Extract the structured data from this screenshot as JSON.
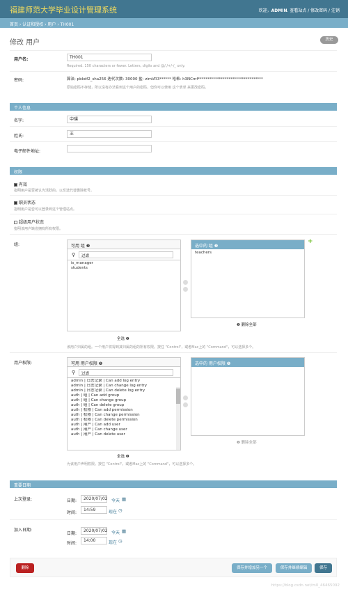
{
  "header": {
    "site_title": "福建师范大学毕业设计管理系统",
    "welcome": "欢迎，",
    "username": "ADMIN",
    "links": ". 查看站点 / 修改密码 / 注销"
  },
  "breadcrumb": "首页 › 认证和授权 › 用户 › TH001",
  "page": {
    "title": "修改 用户",
    "history_button": "历史"
  },
  "account": {
    "username_label": "用户名:",
    "username_value": "TH001",
    "username_help": "Required. 150 characters or fewer. Letters, digits and @/./+/-/_ only.",
    "password_label": "密码:",
    "password_text": "算法: pbkdf2_sha256 迭代次数: 30000 盐: zimVR3****** 哈希: h3NCmf**********************************",
    "password_help": "原始密码不存储，所以没有办法看到这个用户的密码，但你可以使用 这个表单 来更改密码。"
  },
  "personal": {
    "section_title": "个人信息",
    "first_name_label": "名字:",
    "first_name_value": "中璞",
    "last_name_label": "姓氏:",
    "last_name_value": "王",
    "email_label": "电子邮件地址:",
    "email_value": ""
  },
  "permissions": {
    "section_title": "权限",
    "active_label": "有效",
    "active_help": "指明用户是否被认为活跃的。以反选代替删除帐号。",
    "staff_label": "职员状态",
    "staff_help": "指明用户是否可以登录到这个管理站点。",
    "superuser_label": "超级用户状态",
    "superuser_help": "指明该用户缺省拥有所有权限。",
    "groups_label": "组:",
    "groups_available_title": "可用 组 ❷",
    "groups_filter": "过滤",
    "groups_available": [
      "is_manager",
      "students"
    ],
    "groups_chosen_title": "选中的 组 ❷",
    "groups_chosen": [
      "teachers"
    ],
    "groups_select_all": "全选 ❷",
    "groups_remove_all": "❷ 删除全部",
    "groups_help": "该用户归属的组。一个用户将得到其归属的组的所有权限。按住 \"Control\"，或者Mac上的 \"Command\"，可以选择多个。",
    "perms_label": "用户权限:",
    "perms_available_title": "可用 用户权限 ❷",
    "perms_filter": "过滤",
    "perms_available": [
      "admin | 日志记录 | Can add log entry",
      "admin | 日志记录 | Can change log entry",
      "admin | 日志记录 | Can delete log entry",
      "auth | 组 | Can add group",
      "auth | 组 | Can change group",
      "auth | 组 | Can delete group",
      "auth | 权限 | Can add permission",
      "auth | 权限 | Can change permission",
      "auth | 权限 | Can delete permission",
      "auth | 用户 | Can add user",
      "auth | 用户 | Can change user",
      "auth | 用户 | Can delete user"
    ],
    "perms_chosen_title": "选中的 用户权限 ❷",
    "perms_select_all": "全选 ❷",
    "perms_remove_all": "❷ 删除全部",
    "perms_help": "为该用户声明权限。按住 \"Control\"，或者Mac上的 \"Command\"，可以选择多个。"
  },
  "dates": {
    "section_title": "重要日期",
    "last_login_label": "上次登录:",
    "date_label": "日期:",
    "time_label": "时间:",
    "last_login_date": "2020/07/02",
    "last_login_time": "14:59",
    "today_link": "今天",
    "now_link": "现在",
    "joined_label": "加入日期:",
    "joined_date": "2020/07/02",
    "joined_time": "14:00"
  },
  "submit": {
    "delete": "删除",
    "save_add": "保存并增加另一个",
    "save_continue": "保存并继续编辑",
    "save": "保存"
  },
  "watermark": "https://blog.csdn.net/m0_46465092",
  "colors": {
    "header": "#417690",
    "module": "#79aec8",
    "title_yellow": "#f5dd5d",
    "delete_red": "#ba2121"
  }
}
